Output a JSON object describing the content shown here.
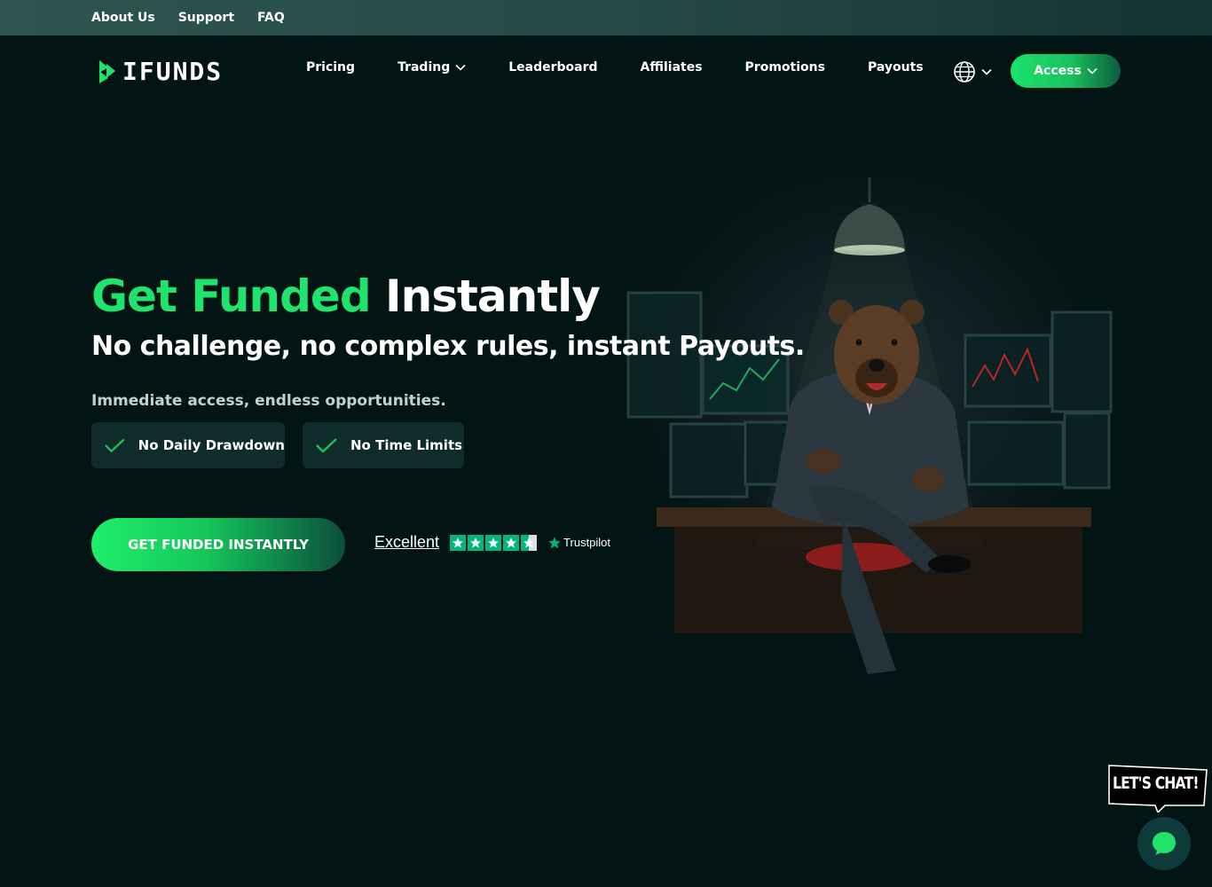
{
  "topbar": {
    "links": [
      "About Us",
      "Support",
      "FAQ"
    ]
  },
  "nav": {
    "logo_text": "IFUNDS",
    "links": [
      {
        "label": "Pricing",
        "dropdown": false
      },
      {
        "label": "Trading",
        "dropdown": true
      },
      {
        "label": "Leaderboard",
        "dropdown": false
      },
      {
        "label": "Affiliates",
        "dropdown": false
      },
      {
        "label": "Promotions",
        "dropdown": false
      },
      {
        "label": "Payouts",
        "dropdown": false
      }
    ],
    "language_icon": "globe-icon",
    "access_label": "Access"
  },
  "hero": {
    "title_green": "Get Funded",
    "title_white": "Instantly",
    "subtitle": "No challenge, no complex rules, instant Payouts.",
    "description": "Immediate access, endless opportunities.",
    "features": [
      "No Daily Drawdown",
      "No Time Limits"
    ],
    "cta_label": "GET FUNDED INSTANTLY",
    "trustpilot": {
      "rating_text": "Excellent",
      "stars": 4.5,
      "brand": "Trustpilot"
    }
  },
  "chat": {
    "label": "LET'S CHAT!",
    "icon": "chat-icon"
  },
  "colors": {
    "background": "#031414",
    "accent_green": "#1fe36d",
    "trustpilot_green": "#00b67a"
  }
}
